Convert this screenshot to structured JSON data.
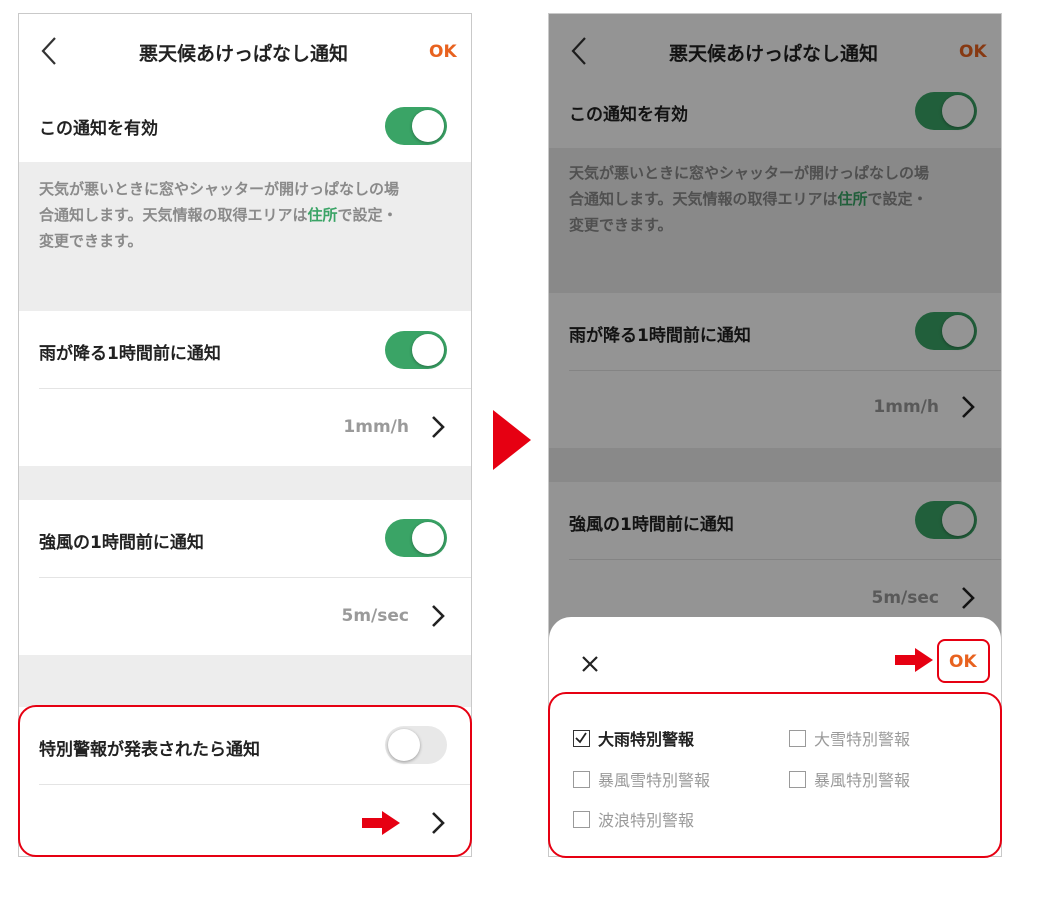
{
  "screen": {
    "title": "悪天候あけっぱなし通知",
    "ok_label": "OK",
    "enable_label": "この通知を有効",
    "description": {
      "line1": "天気が悪いときに窓やシャッターが開けっぱなしの場",
      "line2_pre": "合通知します。天気情報の取得エリアは",
      "link": "住所",
      "line2_post": "で設定・",
      "line3": "変更できます。"
    },
    "rain": {
      "label": "雨が降る1時間前に通知",
      "value": "1mm/h",
      "enabled": true
    },
    "wind": {
      "label": "強風の1時間前に通知",
      "value": "5m/sec",
      "enabled": true
    },
    "warning": {
      "label": "特別警報が発表されたら通知",
      "enabled": false
    }
  },
  "sheet": {
    "close_icon": "close-icon",
    "ok_label": "OK",
    "options": [
      {
        "label": "大雨特別警報",
        "checked": true
      },
      {
        "label": "大雪特別警報",
        "checked": false
      },
      {
        "label": "暴風雪特別警報",
        "checked": false
      },
      {
        "label": "暴風特別警報",
        "checked": false
      },
      {
        "label": "波浪特別警報",
        "checked": false
      }
    ]
  },
  "colors": {
    "accent_green": "#3aa466",
    "ok_orange": "#e8621f",
    "highlight_red": "#e60012"
  }
}
